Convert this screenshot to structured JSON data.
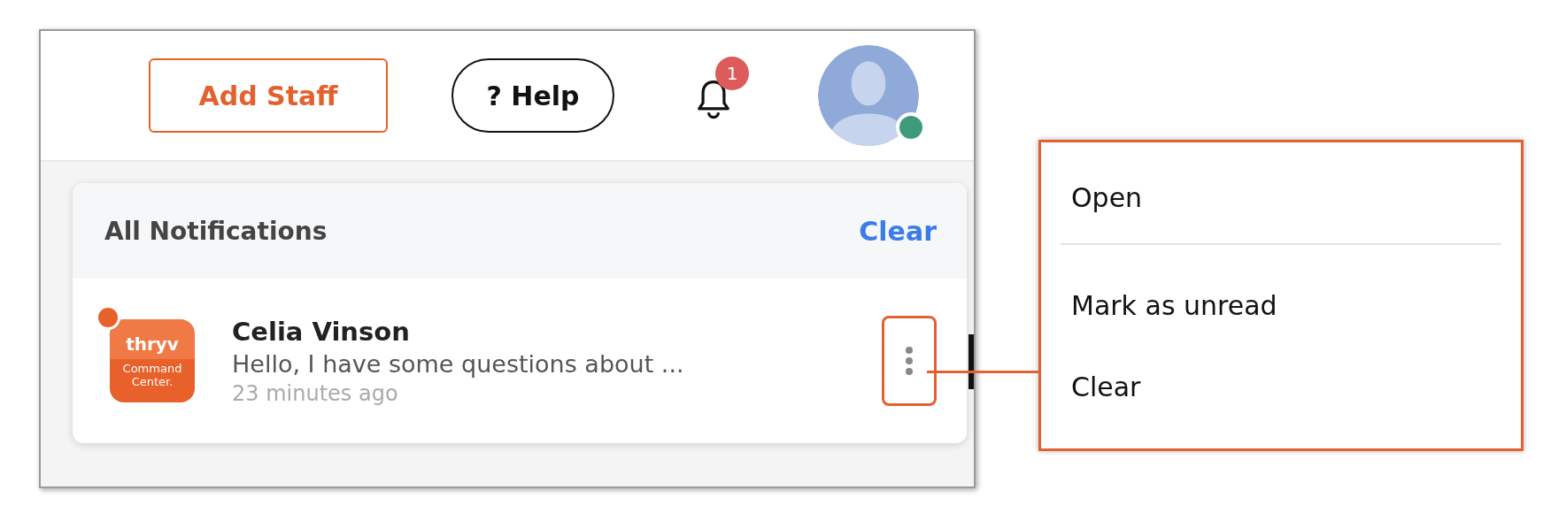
{
  "header": {
    "buttons": [
      {
        "label": "Add Staff",
        "kind": "outline-accent"
      },
      {
        "label": "? Help",
        "kind": "outline-pill"
      }
    ],
    "notification_badge": "1",
    "avatar": {
      "online": true
    }
  },
  "notifications_panel": {
    "title": "All Notifications",
    "clear_link": "Clear",
    "items": [
      {
        "unread": true,
        "app_logo": {
          "brand": "thryv",
          "subtitle": "Command",
          "subtitle_2": "Center."
        },
        "sender": "Celia Vinson",
        "message": "Hello, I have some questions about ...",
        "time": "23 minutes ago",
        "menu_highlighted": true
      }
    ]
  },
  "context_menu": {
    "items": [
      {
        "label": "Open",
        "divider_after": true
      },
      {
        "label": "Mark as unread",
        "divider_after": false
      },
      {
        "label": "Clear",
        "divider_after": false
      }
    ]
  }
}
